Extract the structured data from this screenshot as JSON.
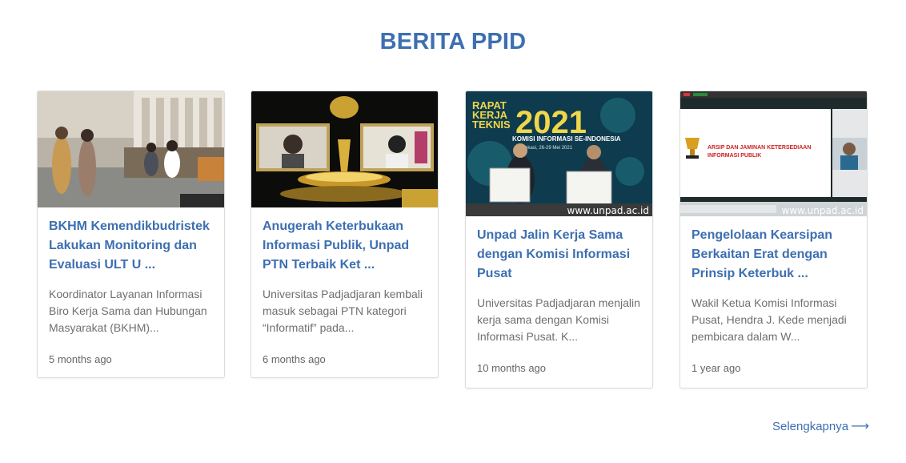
{
  "section": {
    "title": "BERITA PPID"
  },
  "cards": [
    {
      "title": "BKHM Kemendikbudristek Lakukan Monitoring dan Evaluasi ULT U ...",
      "excerpt": "Koordinator Layanan Informasi Biro Kerja Sama dan Hubungan Masyarakat (BKHM)...",
      "time": "5 months ago",
      "image_alt": "Pegawai dan pengunjung di ruang layanan terpadu"
    },
    {
      "title": "Anugerah Keterbukaan Informasi Publik, Unpad PTN Terbaik Ket ...",
      "excerpt": "Universitas Padjadjaran kembali masuk sebagai PTN kategori “Informatif” pada...",
      "time": "6 months ago",
      "image_alt": "Panggung virtual penganugerahan dengan trofi emas"
    },
    {
      "title": "Unpad Jalin Kerja Sama dengan Komisi Informasi Pusat",
      "excerpt": "Universitas Padjadjaran menjalin kerja sama dengan Komisi Informasi Pusat. K...",
      "time": "10 months ago",
      "image_alt": "Penandatanganan kerja sama di depan latar rapat kerja teknis",
      "banner_lines": [
        "RAPAT",
        "KERJA",
        "TEKNIS",
        "2021",
        "KOMISI INFORMASI SE-INDONESIA",
        "Bekasi, 26-29 Mei 2021"
      ],
      "watermark": "www.unpad.ac.id"
    },
    {
      "title": "Pengelolaan Kearsipan Berkaitan Erat dengan Prinsip Keterbuk ...",
      "excerpt": "Wakil Ketua Komisi Informasi Pusat, Hendra J. Kede menjadi pembicara dalam W...",
      "time": "1 year ago",
      "image_alt": "Tangkapan layar presentasi daring",
      "slide_lines": [
        "ARSIP DAN JAMINAN KETERSEDIAAN",
        "INFORMASI PUBLIK"
      ],
      "watermark": "www.unpad.ac.id"
    }
  ],
  "more": {
    "label": "Selengkapnya",
    "icon": "arrow-right-icon"
  },
  "colors": {
    "accent": "#3d6fb1",
    "text_muted": "#6f6f6f",
    "border": "#dcdcdc"
  }
}
